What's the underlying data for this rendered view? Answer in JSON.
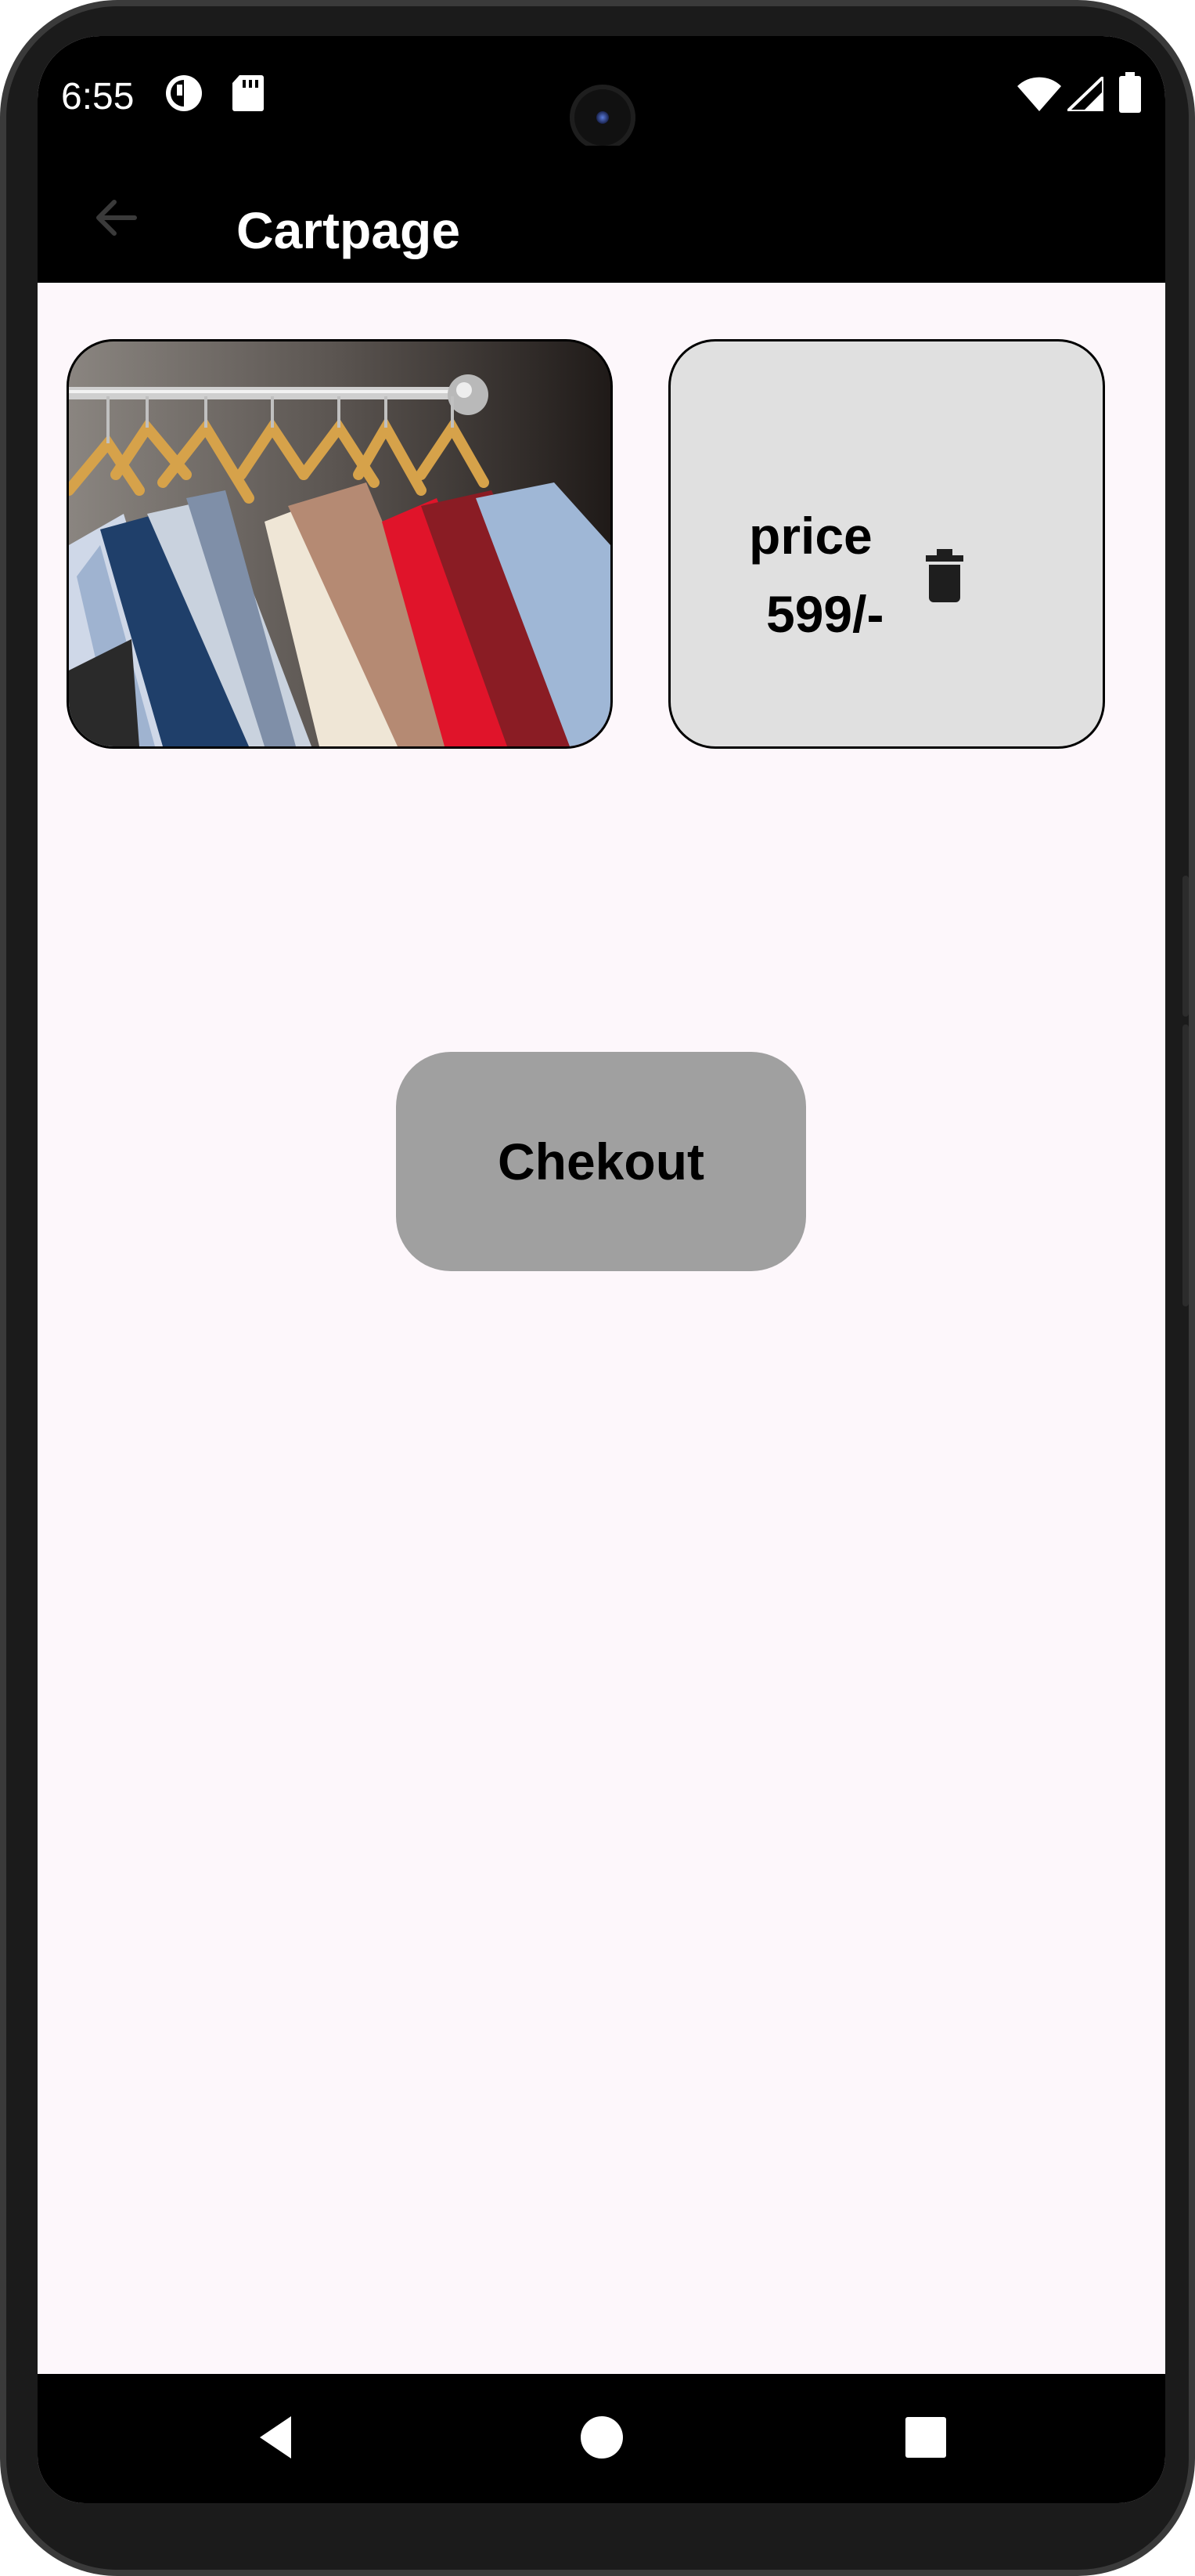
{
  "status_bar": {
    "time": "6:55",
    "icons": [
      "notification-icon",
      "sd-card-icon",
      "wifi-icon",
      "signal-icon",
      "battery-icon"
    ]
  },
  "app_bar": {
    "title": "Cartpage",
    "back_icon": "arrow-back-icon"
  },
  "cart": {
    "items": [
      {
        "image": "clothes-on-hangers",
        "price_label": "price",
        "price_value": "599/-",
        "delete_icon": "trash-icon"
      }
    ],
    "checkout_label": "Chekout"
  },
  "nav_bar": {
    "icons": [
      "back-triangle-icon",
      "home-circle-icon",
      "recents-square-icon"
    ]
  },
  "colors": {
    "app_bar": "#000000",
    "background": "#fdf7fb",
    "price_card": "#e0e0e0",
    "checkout_button": "#a0a0a0"
  }
}
